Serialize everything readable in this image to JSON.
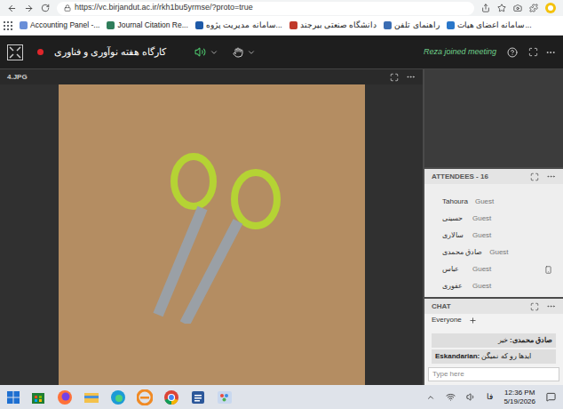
{
  "browser": {
    "url": "https://vc.birjandut.ac.ir/rkh1bu5yrmse/?proto=true",
    "bookmarks": [
      "Accounting Panel -...",
      "Journal Citation Re...",
      "سامانه مدیریت پژوه...",
      "دانشگاه صنعتی بیرجند",
      "راهنمای تلفن",
      "سامانه اعضای هیات..."
    ]
  },
  "meeting": {
    "title": "کارگاه هفته نوآوری و فناوری",
    "notice": "Reza joined meeting"
  },
  "share_pod": {
    "title": "4.JPG"
  },
  "attendees": {
    "title": "ATTENDEES - 16",
    "items": [
      {
        "name": "Tahoura",
        "role": "Guest",
        "on_phone": false
      },
      {
        "name": "حسینی",
        "role": "Guest",
        "on_phone": false
      },
      {
        "name": "سالاری",
        "role": "Guest",
        "on_phone": false
      },
      {
        "name": "صادق محمدی",
        "role": "Guest",
        "on_phone": false
      },
      {
        "name": "عباس",
        "role": "Guest",
        "on_phone": true
      },
      {
        "name": "عفوری",
        "role": "Guest",
        "on_phone": false
      }
    ]
  },
  "chat": {
    "title": "CHAT",
    "recipient": "Everyone",
    "messages": [
      {
        "sender": "صادق محمدی:",
        "text": "خیر"
      },
      {
        "sender": "Eskandarian:",
        "text": "ایدها رو که نمیگن"
      }
    ],
    "placeholder": "Type here"
  },
  "taskbar": {
    "language": "فا",
    "time": "12:36 PM",
    "date": "5/19/2026"
  }
}
